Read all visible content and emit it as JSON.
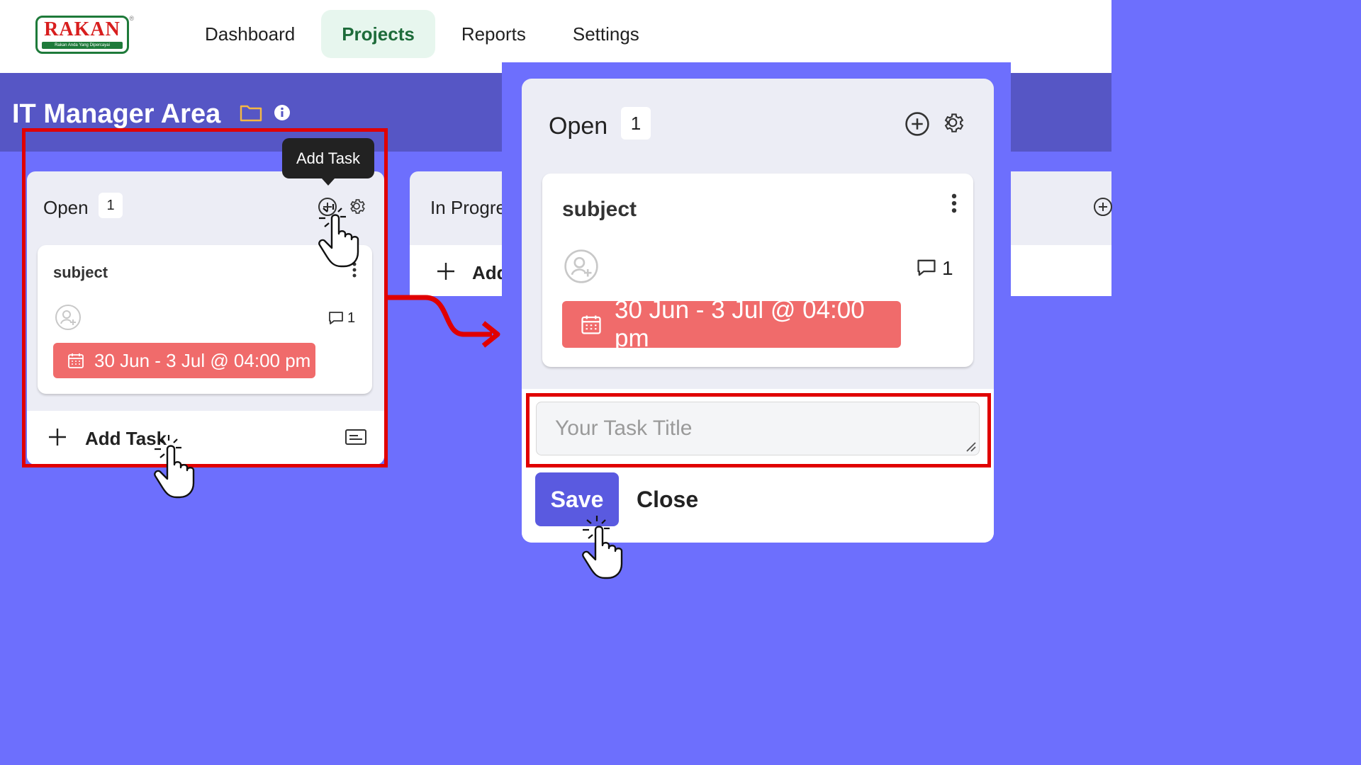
{
  "brand": {
    "name": "RAKAN",
    "tagline": "Rakan Anda Yang Dipercayai"
  },
  "nav": {
    "items": [
      "Dashboard",
      "Projects",
      "Reports",
      "Settings"
    ],
    "active": "Projects"
  },
  "page": {
    "title": "IT Manager Area"
  },
  "tooltip": {
    "text": "Add Task"
  },
  "columns": [
    {
      "title": "Open",
      "count": "1",
      "card": {
        "subject": "subject",
        "comment_count": "1",
        "date": "30 Jun - 3 Jul @ 04:00 pm"
      },
      "add_task_label": "Add Task"
    },
    {
      "title": "In Progre",
      "add_task_label": "Add"
    }
  ],
  "zoom": {
    "column_title": "Open",
    "count": "1",
    "card": {
      "subject": "subject",
      "comment_count": "1",
      "date": "30 Jun - 3 Jul @ 04:00 pm"
    },
    "task_input": {
      "placeholder": "Your Task Title",
      "value": ""
    },
    "save_label": "Save",
    "close_label": "Close"
  },
  "colors": {
    "accent": "#5a5ae0",
    "date_badge": "#f06b6b",
    "highlight": "#e00000",
    "background": "#6d6ffd",
    "nav_active": "#e7f6ee"
  },
  "icons": [
    "folder-icon",
    "info-icon",
    "add-circle-icon",
    "gear-icon",
    "more-vertical-icon",
    "assign-user-icon",
    "comment-icon",
    "calendar-icon",
    "plus-icon",
    "card-template-icon",
    "pointer-hand-icon",
    "arrow-icon"
  ]
}
